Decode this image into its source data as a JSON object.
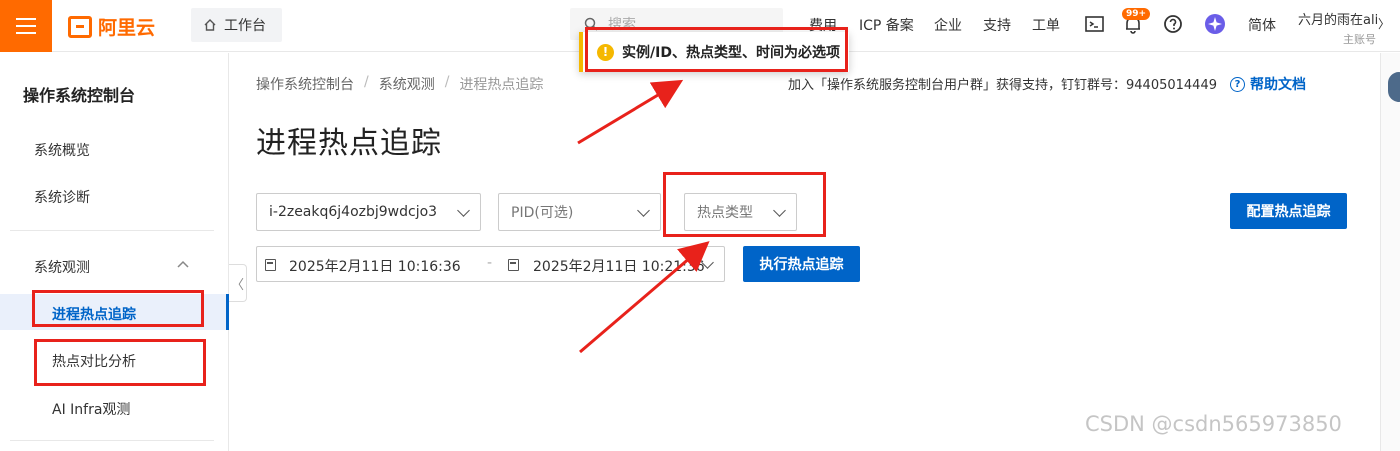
{
  "header": {
    "brand": "阿里云",
    "workbench": "工作台",
    "search_placeholder": "搜索",
    "nav": [
      "费用",
      "ICP 备案",
      "企业",
      "支持",
      "工单"
    ],
    "notification_badge": "99+",
    "language": "简体",
    "user_name": "六月的雨在ali",
    "user_role": "主账号"
  },
  "sidebar": {
    "title": "操作系统控制台",
    "items": [
      "系统概览",
      "系统诊断"
    ],
    "group_label": "系统观测",
    "sub_items": [
      "进程热点追踪",
      "热点对比分析",
      "AI Infra观测"
    ]
  },
  "breadcrumb": [
    "操作系统控制台",
    "系统观测",
    "进程热点追踪"
  ],
  "support_text": "加入「操作系统服务控制台用户群」获得支持，钉钉群号：94405014449",
  "help_label": "帮助文档",
  "page_title": "进程热点追踪",
  "form": {
    "instance_value": "i-2zeakq6j4ozbj9wdcjo3",
    "pid_placeholder": "PID(可选)",
    "hotspot_type_placeholder": "热点类型",
    "configure_button": "配置热点追踪",
    "start_time": "2025年2月11日 10:16:36",
    "end_time": "2025年2月11日 10:21:36",
    "execute_button": "执行热点追踪"
  },
  "tooltip": "实例/ID、热点类型、时间为必选项",
  "watermark": "CSDN @csdn565973850",
  "colors": {
    "brand": "#ff6a00",
    "primary": "#0064c8",
    "annotation": "#e8221b",
    "warning": "#f5b800"
  }
}
